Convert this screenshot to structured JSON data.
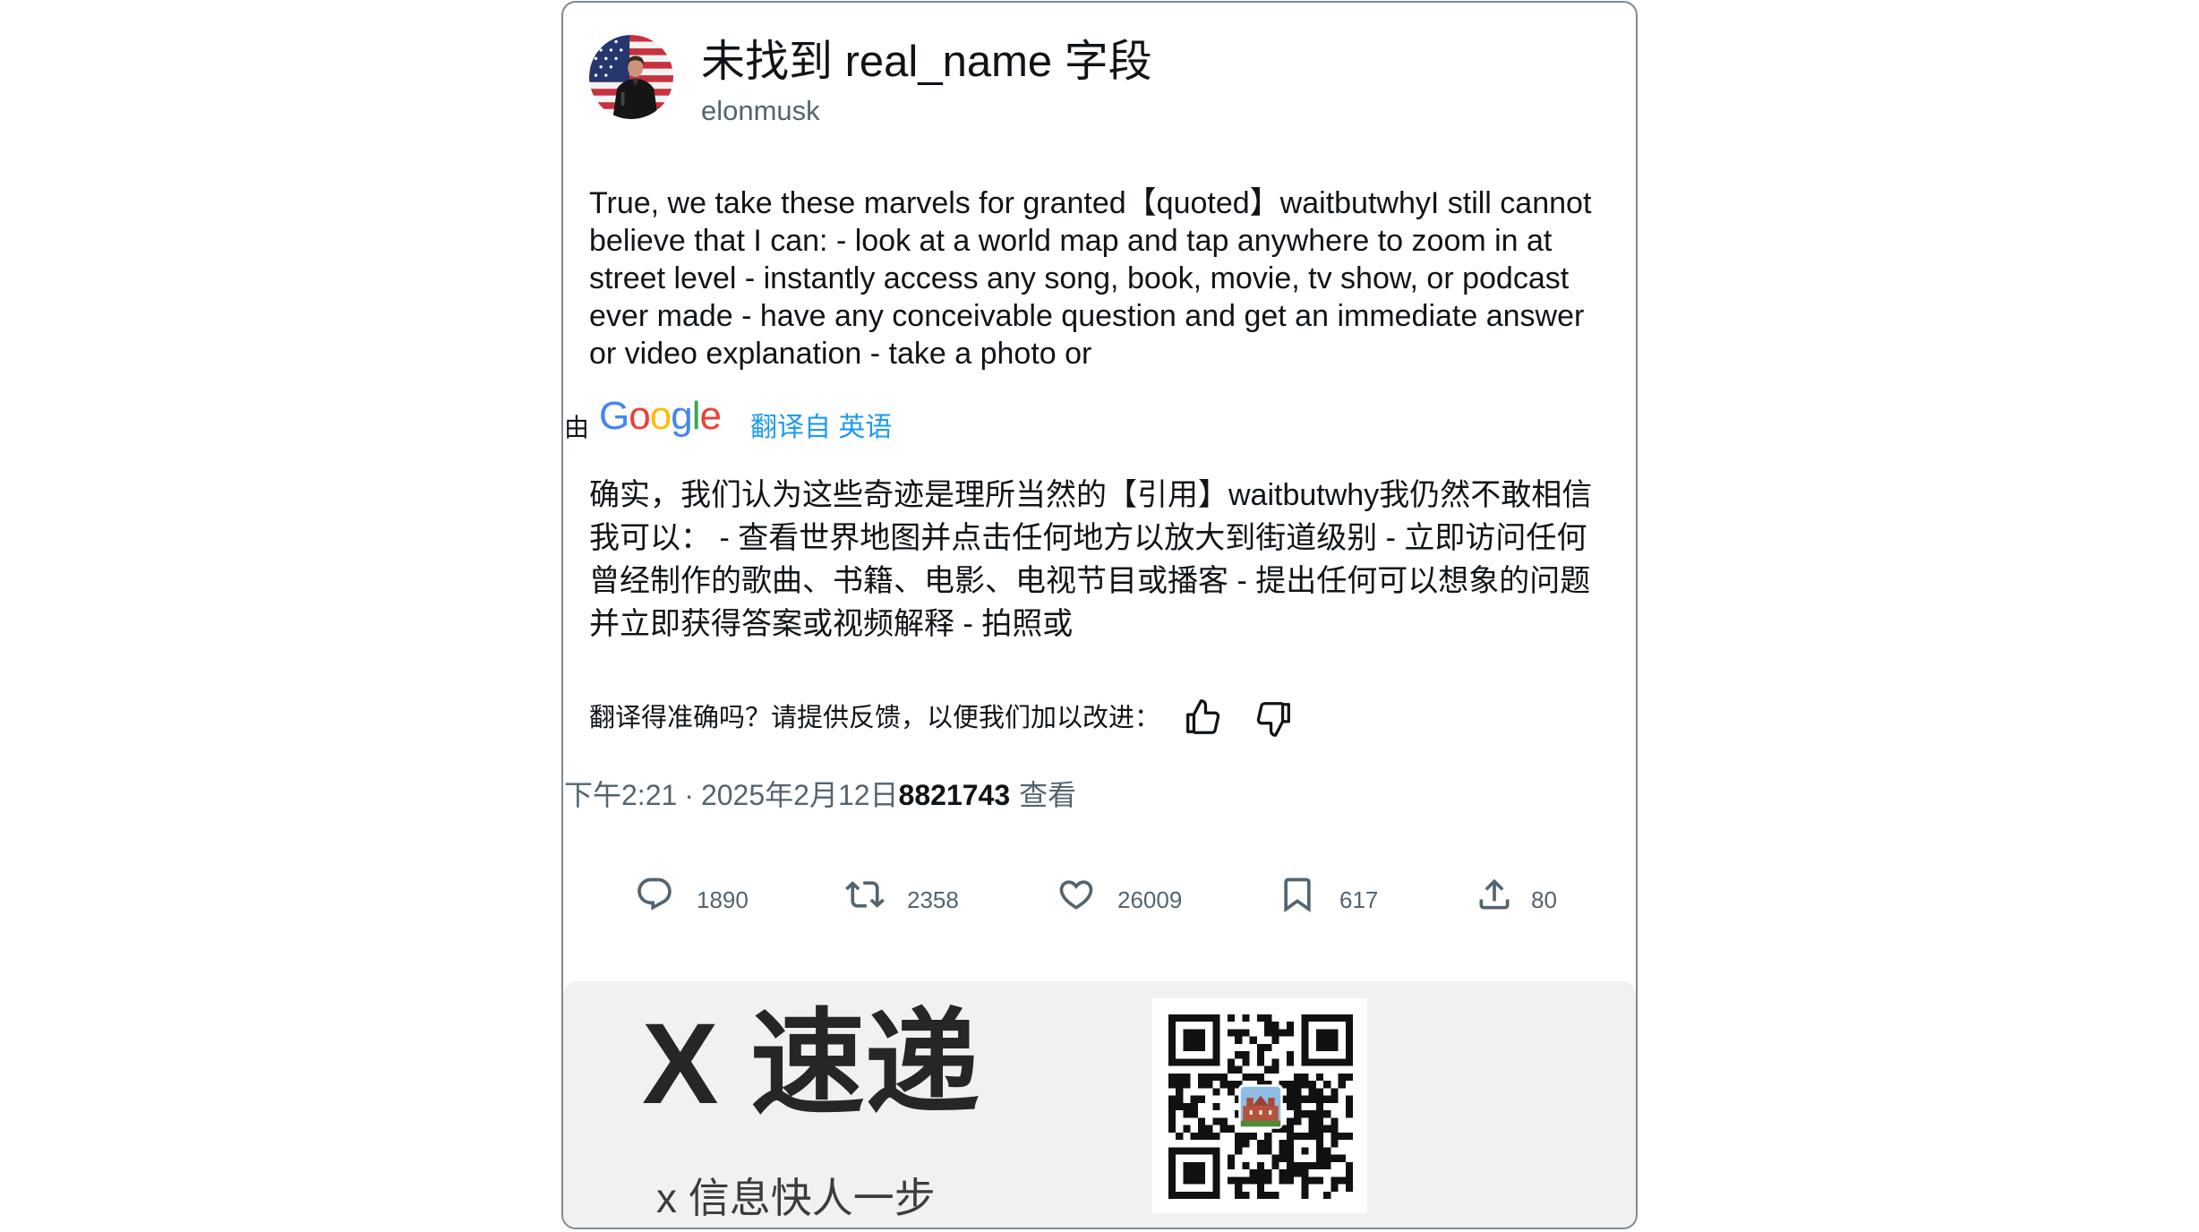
{
  "author": {
    "display_name": "未找到 real_name 字段",
    "handle": "elonmusk",
    "avatar_icon": "avatar-photo"
  },
  "tweet": {
    "text": "True, we take these marvels for granted【quoted】waitbutwhyI still cannot believe that I can: - look at a world map and tap anywhere to zoom in at street level - instantly access any song, book, movie, tv show, or podcast ever made - have any conceivable question and get an immediate answer or video explanation - take a photo or",
    "translation_prefix": "由",
    "google_logo": {
      "text": "Google",
      "colors": [
        "#4285F4",
        "#EA4335",
        "#FBBC05",
        "#4285F4",
        "#34A853",
        "#EA4335"
      ]
    },
    "translated_from": "翻译自 英语",
    "translation": "确实，我们认为这些奇迹是理所当然的【引用】waitbutwhy我仍然不敢相信我可以： - 查看世界地图并点击任何地方以放大到街道级别 - 立即访问任何曾经制作的歌曲、书籍、电影、电视节目或播客 - 提出任何可以想象的问题并立即获得答案或视频解释 - 拍照或",
    "feedback_prompt": "翻译得准确吗？请提供反馈，以便我们加以改进：",
    "feedback_icons": [
      "thumbs-up-icon",
      "thumbs-down-icon"
    ]
  },
  "meta": {
    "time": "下午2:21",
    "separator": "·",
    "date": "2025年2月12日",
    "views": "8821743",
    "views_label": "查看"
  },
  "actions": [
    {
      "icon": "reply-icon",
      "count": "1890"
    },
    {
      "icon": "retweet-icon",
      "count": "2358"
    },
    {
      "icon": "like-icon",
      "count": "26009"
    },
    {
      "icon": "bookmark-icon",
      "count": "617"
    },
    {
      "icon": "share-icon",
      "count": "80"
    }
  ],
  "footer": {
    "brand": "X 速递",
    "slogan": "x 信息快人一步",
    "qr_icon": "qr-code"
  },
  "colors": {
    "accent": "#1d9bf0",
    "muted": "#536471",
    "text": "#0f1419",
    "footer_bg": "#f1f1f1",
    "card_border": "#7d8b97"
  }
}
